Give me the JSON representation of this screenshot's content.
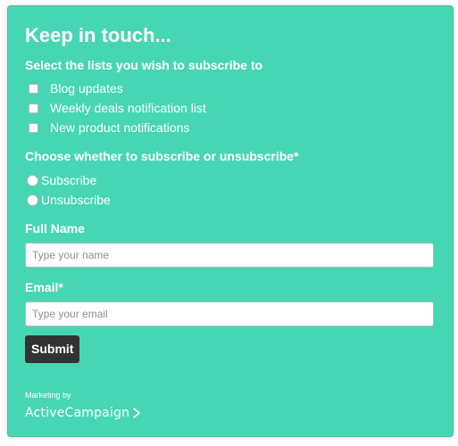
{
  "form": {
    "title": "Keep in touch...",
    "lists_label": "Select the lists you wish to subscribe to",
    "lists": [
      {
        "label": "Blog updates",
        "checked": false
      },
      {
        "label": "Weekly deals notification list",
        "checked": false
      },
      {
        "label": "New product notifications",
        "checked": false
      }
    ],
    "subscribe_label": "Choose whether to subscribe or unsubscribe*",
    "options": [
      {
        "label": "Subscribe",
        "selected": false
      },
      {
        "label": "Unsubscribe",
        "selected": false
      }
    ],
    "name_label": "Full Name",
    "name_placeholder": "Type your name",
    "email_label": "Email*",
    "email_placeholder": "Type your email",
    "submit_label": "Submit"
  },
  "footer": {
    "marketing_by": "Marketing by",
    "brand": "ActiveCampaign",
    "brand_icon": "chevron-right-icon"
  },
  "colors": {
    "background": "#47d6b4",
    "button": "#333333",
    "text": "#ffffff"
  }
}
